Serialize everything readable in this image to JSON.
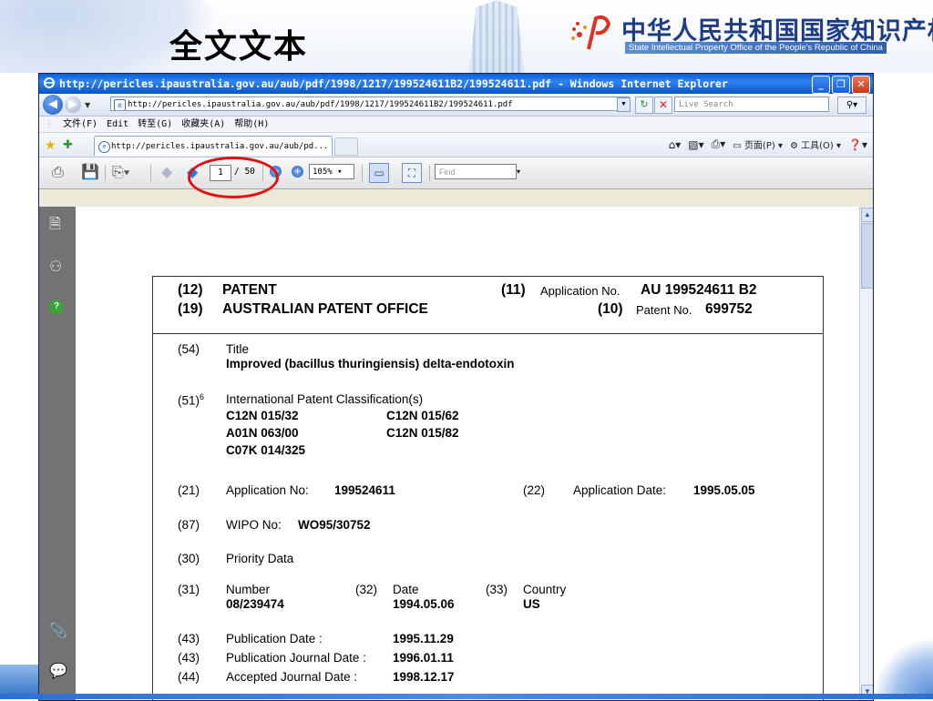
{
  "slide": {
    "title": "全文文本",
    "org_name_cn": "中华人民共和国国家知识产权局",
    "org_name_en": "State Intellectual Property Office of the People's Republic of China"
  },
  "browser": {
    "window_title": "http://pericles.ipaustralia.gov.au/aub/pdf/1998/1217/199524611B2/199524611.pdf - Windows Internet Explorer",
    "address": "http://pericles.ipaustralia.gov.au/aub/pdf/1998/1217/199524611B2/199524611.pdf",
    "search_placeholder": "Live Search",
    "menu": [
      "文件(F)",
      "Edit",
      "转至(G)",
      "收藏夹(A)",
      "帮助(H)"
    ],
    "tab_title": "http://pericles.ipaustralia.gov.au/aub/pd...",
    "command_bar": {
      "page": "页面(P)",
      "tools": "工具(O)"
    }
  },
  "pdf_toolbar": {
    "current_page": "1",
    "total_pages": "/ 50",
    "zoom": "105%",
    "find_placeholder": "Find"
  },
  "document": {
    "header": {
      "c12": "(12)",
      "patent_label": "PATENT",
      "c19": "(19)",
      "office": "AUSTRALIAN PATENT OFFICE",
      "c11": "(11)",
      "app_no_label": "Application No.",
      "app_no": "AU 199524611 B2",
      "c10": "(10)",
      "patent_no_label": "Patent No.",
      "patent_no": "699752"
    },
    "f54": {
      "code": "(54)",
      "label": "Title",
      "value": "Improved (bacillus thuringiensis) delta-endotoxin"
    },
    "f51": {
      "code": "(51)",
      "sup": "6",
      "label": "International Patent Classification(s)",
      "classes": [
        "C12N 015/32",
        "C12N 015/62",
        "A01N 063/00",
        "C12N 015/82",
        "C07K 014/325"
      ]
    },
    "f21": {
      "code": "(21)",
      "label": "Application No:",
      "value": "199524611"
    },
    "f22": {
      "code": "(22)",
      "label": "Application Date:",
      "value": "1995.05.05"
    },
    "f87": {
      "code": "(87)",
      "label": "WIPO No:",
      "value": "WO95/30752"
    },
    "f30": {
      "code": "(30)",
      "label": "Priority Data"
    },
    "f31": {
      "code": "(31)",
      "label": "Number",
      "value": "08/239474"
    },
    "f32": {
      "code": "(32)",
      "label": "Date",
      "value": "1994.05.06"
    },
    "f33": {
      "code": "(33)",
      "label": "Country",
      "value": "US"
    },
    "f43a": {
      "code": "(43)",
      "label": "Publication Date :",
      "value": "1995.11.29"
    },
    "f43b": {
      "code": "(43)",
      "label": "Publication Journal Date :",
      "value": "1996.01.11"
    },
    "f44": {
      "code": "(44)",
      "label": "Accepted Journal Date :",
      "value": "1998.12.17"
    }
  }
}
